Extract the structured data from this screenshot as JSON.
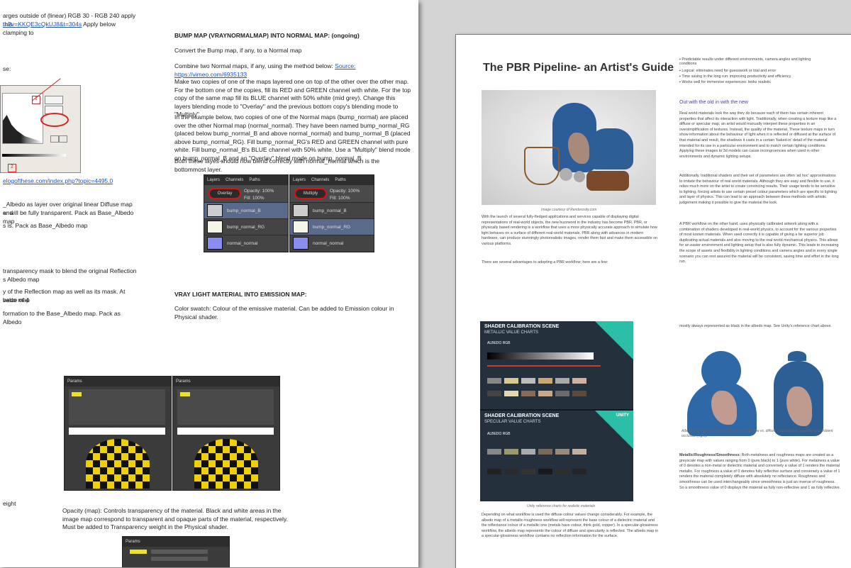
{
  "left": {
    "top_fragment_1": "arges outside of (linear) RGB 30 - RGB 240 apply this",
    "top_link": "t=2v=KKQE3cQkUJ8&t=304s",
    "top_link_tail": " Apply below clamping to",
    "se_label": "se:",
    "dialog_link": "elogofthese.com/index.php?topic=4495.0",
    "frag_albedo_1": "_Albedo as layer over original linear Diffuse map and",
    "frag_albedo_2": "er will be fully transparent. Pack as Base_Albedo map",
    "frag_albedo_3": "s is. Pack as Base_Albedo map",
    "frag_refl_1": "transparency mask to blend the original Reflection",
    "frag_refl_2": "s Albedo map",
    "frag_refl_3": "y of the Reflection map as well as its mask. At value of 4",
    "frag_refl_4": "bedo map",
    "frag_refl_5": "formation to the Base_Albedo map. Pack as Albedo",
    "frag_bottom": "eight",
    "bump_heading": "BUMP MAP (VRAYNORMALMAP) INTO NORMAL MAP: (ongoing)",
    "bump_p1": "Convert the Bump map, if any, to a Normal map",
    "bump_p2_pre": "Combine two Normal maps, if any, using the method below: ",
    "bump_p2_source": "Source: https://vimeo.com/6935133",
    "bump_p3": "Make two copies of one of the maps layered one on top of the other over the other map. For the bottom one of the copies, fill its RED and GREEN channel with white. For the top copy of the same map fill its BLUE channel with 50% white (mid grey). Change this layers blending mode to \"Overlay\" and the previous bottom copy's blending mode to \"Multiply\"",
    "bump_p4": "In the example below, two copies of one of the Normal maps (bump_normal) are placed over the other Normal map (normal_normal). They have been named bump_normal_RG (placed below bump_normal_B and above normal_normal) and bump_normal_B (placed above bump_normal_RG). Fill bump_normal_RG's RED and GREEN channel with pure white. Fill bump_normal_B's BLUE channel with 50% white. Use a \"Multiply\" blend mode on bump_normal_B and an \"Overlay\" blend mode on bump_normal_B",
    "bump_p5": "Both these layes should now blend correctly with normal_normal which is the bottommost layer.",
    "vray_heading": "VRAY LIGHT MATERIAL INTO EMISSION MAP:",
    "vray_p1": "Color swatch: Colour of the emissive material. Can be added to Emission colour in Physical shader.",
    "opacity_p": "Opacity (map): Controls transparency of the material. Black and white areas in the image map correspond to transparent and opaque parts of the material, respectively. Must be added to Transparency weight in the Physical shader.",
    "layers_panel_1": {
      "tabs": [
        "Layers",
        "Channels",
        "Paths"
      ],
      "blend": "Overlay",
      "opacity": "Opacity: 100%",
      "fill": "Fill: 100%",
      "layers": [
        "bump_normal_B",
        "bump_normal_RG",
        "normal_normal"
      ]
    },
    "layers_panel_2": {
      "tabs": [
        "Layers",
        "Channels",
        "Paths"
      ],
      "blend": "Multiply",
      "opacity": "Opacity: 100%",
      "fill": "Fill: 100%",
      "layers": [
        "bump_normal_B",
        "bump_normal_RG",
        "normal_normal"
      ]
    },
    "params_label": "Params"
  },
  "right": {
    "title": "The PBR Pipeline- an Artist's Guide",
    "image_caption": "Image courtesy of Renderosity.com",
    "intro_p": "With the launch of several fully-fledged applications and services capable of displaying digital representations of real-world objects, the new buzzword in the industry has become PBR. PBR, or physically based rendering is a workflow that uses a more physically accurate approach to simulate how light behaves on a surface of different real-world materials. PBR along with advances in modern hardware, can produce stunningly photorealistic images, render them fast and make them accessible on various platforms.",
    "adv_p": "There are several advantages to adopting a PBR workflow; here are a few:",
    "bullets": [
      "Predictable results under different environments, camera angles and lighting conditions",
      "Logical: eliminates need for guesswork or trial and error",
      "Time saving in the long run: improving productivity and efficiency",
      "Works well for immersive experiences: looks realistic"
    ],
    "out_heading": "Out with the old in with the new",
    "out_p1": "Real world materials look the way they do because each of them has certain inherent properties that affect its interaction with light. Traditionally, when creating a texture map like a diffuse or specular map, an artist would manually interpret these properties in an oversimplification of textures. Instead, the quality of the material. These texture maps in turn show information about the behaviour of light when it is reflected or diffused at the surface of that material and result, the shadows it casts in a certain 'baked-in' detail of the material intended for its use in a particular environment and to match certain lighting conditions. Applying these images to 3d models can cause incongruencies when used in other environments and dynamic lighting setups.",
    "out_p2": "Additionally, traditional shaders and their set of parameters are often 'ad hoc' approximations to imitate the behaviour of real world materials. Although they are easy and flexible to use, it relies much more on the artist to create convincing results. Their usage tends to be sensitive to lighting, forcing artists to use certain preset colour parameters which are specific to lighting and layer of physics. This can lead to an approach between these methods with artistic judgement making it possible to give the material the look.",
    "out_p3": "A PBR workflow on the other hand, uses physically calibrated artwork along with a combination of shaders developed in real-world physics, to account for the various properties of most known materials. When used correctly it is capable of giving a far superior job duplicating actual materials and also moving to the real world mechanical physics. This allows for an easier environment and lighting setup that is also fully dynamic. This leads to increasing the scope of assets and flexibility in lighting conditions and camera angles and in every single scenario you can rest assured the material will be consistent, saving time and effort in the long run.",
    "chart_panel": {
      "title_1": "SHADER CALIBRATION SCENE",
      "subtitle_1": "METALLIC VALUE CHARTS",
      "label_1": "ALBEDO RGB",
      "title_2": "SHADER CALIBRATION SCENE",
      "subtitle_2": "SPECULAR VALUE CHARTS",
      "label_2": "ALBEDO RGB",
      "brand": "UNITY"
    },
    "chart_caption": "Unity reference charts for realistic materials",
    "bottom_p1": "Depending on what workflow is used the diffuse colour values change considerably. For example, the albedo map of a metallic-roughness workflow will represent the base colour of a dielectric material and the reflectance colour of a metallic one (metals have colour, think gold, copper). In a specular-glossiness workflow, the albedo map represents the colour of diffuse and specularity is reflected. The albedo map in a specular-glossiness workflow contains no reflection information for the surface.",
    "right_top_note": "mostly always represented as black in the albedo map. See Unity's reference chart above.",
    "vase_caption": "Albedo map (left) for metallic-roughness workflow vs. diffuse with baked-in specular and ambient occlusion (right).",
    "metal_p_head": "Metallic/Roughness/Smoothness:",
    "metal_p": " Both metalness and roughness maps are created as a greyscale map with values ranging from 0 (pure black) to 1 (pure white). For metalness a value of 0 denotes a non-metal or dielectric material and conversely a value of 1 renders the material metallic. For roughness a value of 0 denotes fully reflective surface and conversely a value of 1 renders the material completely diffuse with absolutely no reflectance. Roughness and smoothness can be used interchangeably since smoothness is just an inverse of roughness. So a smoothness value of 0 displays the material as fully non-reflective and 1 as fully reflective."
  }
}
